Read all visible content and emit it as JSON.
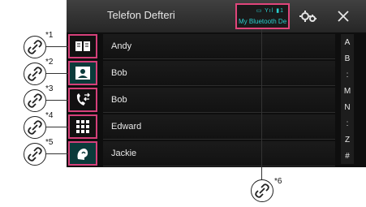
{
  "header": {
    "title": "Telefon Defteri",
    "bt_status": "▭ Yıl ▮1",
    "bt_device": "My Bluetooth De"
  },
  "contacts": [
    "Andy",
    "Bob",
    "Bob",
    "Edward",
    "Jackie"
  ],
  "index_letters": [
    "A",
    "B",
    ":",
    "M",
    "N",
    ":",
    "Z",
    "#"
  ],
  "callouts": [
    "*1",
    "*2",
    "*3",
    "*4",
    "*5",
    "*6"
  ],
  "colors": {
    "accent": "#2ad0d0",
    "highlight": "#e0457b"
  }
}
